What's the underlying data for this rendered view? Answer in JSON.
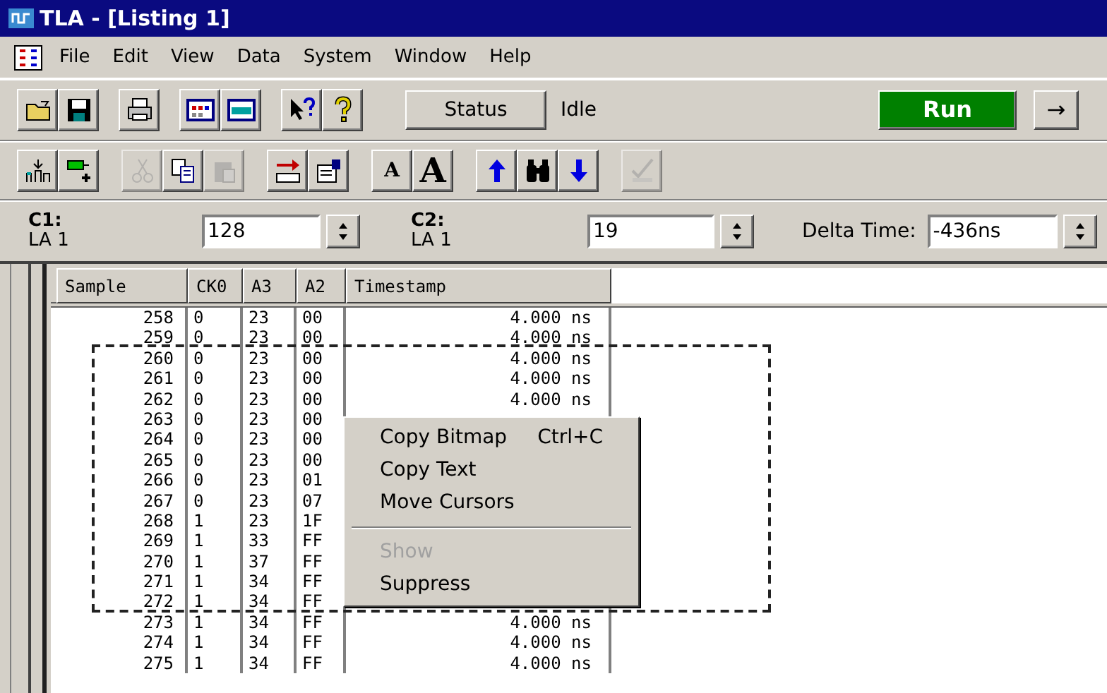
{
  "window": {
    "title": "TLA - [Listing 1]"
  },
  "menu_bar": [
    "File",
    "Edit",
    "View",
    "Data",
    "System",
    "Window",
    "Help"
  ],
  "toolbar": {
    "groups": [
      [
        {
          "kind": "open",
          "disabled": false
        },
        {
          "kind": "save",
          "disabled": false
        }
      ],
      [
        {
          "kind": "print",
          "disabled": false
        }
      ],
      [
        {
          "kind": "window-grid",
          "disabled": false
        },
        {
          "kind": "new-window",
          "disabled": false
        }
      ],
      [
        {
          "kind": "context-help",
          "disabled": false
        },
        {
          "kind": "help",
          "disabled": false
        }
      ]
    ],
    "status_button": "Status",
    "status_text": "Idle",
    "run_button": "Run",
    "arrow_button": "→"
  },
  "toolbar_2": {
    "groups": [
      [
        {
          "kind": "split",
          "disabled": false
        },
        {
          "kind": "add-column",
          "disabled": false
        }
      ],
      [
        {
          "kind": "cut",
          "disabled": true
        },
        {
          "kind": "copy",
          "disabled": false
        },
        {
          "kind": "paste",
          "disabled": true
        }
      ],
      [
        {
          "kind": "goto",
          "disabled": false
        },
        {
          "kind": "properties",
          "disabled": false
        }
      ],
      [
        {
          "kind": "letter-small",
          "label": "A",
          "disabled": false
        },
        {
          "kind": "letter-large",
          "label": "A",
          "disabled": false
        }
      ],
      [
        {
          "kind": "up",
          "disabled": false
        },
        {
          "kind": "find",
          "disabled": false
        },
        {
          "kind": "down",
          "disabled": false
        }
      ],
      [
        {
          "kind": "opcode",
          "disabled": true
        }
      ]
    ]
  },
  "cursors": {
    "c1": {
      "label": "C1:",
      "source": "LA 1",
      "value": "128"
    },
    "c2": {
      "label": "C2:",
      "source": "LA 1",
      "value": "19"
    },
    "delta": {
      "label": "Delta Time:",
      "value": "-436ns"
    }
  },
  "table": {
    "columns": [
      "Sample",
      "CK0",
      "A3",
      "A2",
      "Timestamp"
    ],
    "rows": [
      [
        "258",
        "0",
        "23",
        "00",
        "4.000 ns"
      ],
      [
        "259",
        "0",
        "23",
        "00",
        "4.000 ns"
      ],
      [
        "260",
        "0",
        "23",
        "00",
        "4.000 ns"
      ],
      [
        "261",
        "0",
        "23",
        "00",
        "4.000 ns"
      ],
      [
        "262",
        "0",
        "23",
        "00",
        "4.000 ns"
      ],
      [
        "263",
        "0",
        "23",
        "00"
      ],
      [
        "264",
        "0",
        "23",
        "00"
      ],
      [
        "265",
        "0",
        "23",
        "00"
      ],
      [
        "266",
        "0",
        "23",
        "01"
      ],
      [
        "267",
        "0",
        "23",
        "07"
      ],
      [
        "268",
        "1",
        "23",
        "1F"
      ],
      [
        "269",
        "1",
        "33",
        "FF"
      ],
      [
        "270",
        "1",
        "37",
        "FF"
      ],
      [
        "271",
        "1",
        "34",
        "FF"
      ],
      [
        "272",
        "1",
        "34",
        "FF"
      ],
      [
        "273",
        "1",
        "34",
        "FF",
        "4.000 ns"
      ],
      [
        "274",
        "1",
        "34",
        "FF",
        "4.000 ns"
      ],
      [
        "275",
        "1",
        "34",
        "FF",
        "4.000 ns"
      ]
    ]
  },
  "context_menu": [
    {
      "kind": "item",
      "label": "Copy Bitmap",
      "shortcut": "Ctrl+C",
      "disabled": false
    },
    {
      "kind": "item",
      "label": "Copy Text",
      "disabled": false
    },
    {
      "kind": "item",
      "label": "Move Cursors",
      "disabled": false
    },
    {
      "kind": "separator"
    },
    {
      "kind": "item",
      "label": "Show",
      "disabled": true
    },
    {
      "kind": "item",
      "label": "Suppress",
      "disabled": false
    }
  ]
}
